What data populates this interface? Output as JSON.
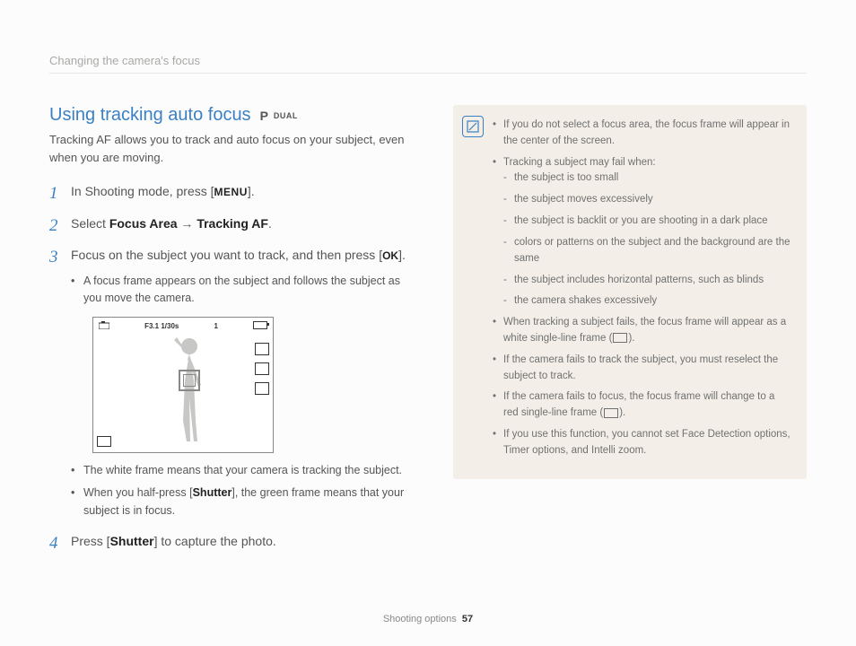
{
  "breadcrumb": "Changing the camera's focus",
  "title": "Using tracking auto focus",
  "mode_badges": {
    "p": "P",
    "dual": "DUAL"
  },
  "intro": "Tracking AF allows you to track and auto focus on your subject, even when you are moving.",
  "steps": {
    "s1_a": "In Shooting mode, press [",
    "s1_menu": "MENU",
    "s1_b": "].",
    "s2_a": "Select ",
    "s2_focus": "Focus Area",
    "s2_arrow": " → ",
    "s2_track": "Tracking AF",
    "s2_b": ".",
    "s3_a": "Focus on the subject you want to track, and then press [",
    "s3_ok": "OK",
    "s3_b": "].",
    "s3_sub1": "A focus frame appears on the subject and follows the subject as you move the camera.",
    "s3_sub2": "The white frame means that your camera is tracking the subject.",
    "s3_sub3_a": "When you half-press [",
    "s3_sub3_shutter": "Shutter",
    "s3_sub3_b": "], the green frame means that your subject is in focus.",
    "s4_a": "Press [",
    "s4_shutter": "Shutter",
    "s4_b": "] to capture the photo."
  },
  "lcd": {
    "fstop": "F3.1",
    "shutter": "1/30s",
    "count": "1"
  },
  "note": {
    "n1": "If you do not select a focus area, the focus frame will appear in the center of the screen.",
    "n2": "Tracking a subject may fail when:",
    "n2a": "the subject is too small",
    "n2b": "the subject moves excessively",
    "n2c": "the subject is backlit or you are shooting in a dark place",
    "n2d": "colors or patterns on the subject and the background are the same",
    "n2e": "the subject includes horizontal patterns, such as blinds",
    "n2f": "the camera shakes excessively",
    "n3a": "When tracking a subject fails, the focus frame will appear as a white single-line frame (",
    "n3b": ").",
    "n4": "If the camera fails to track the subject, you must reselect the subject to track.",
    "n5a": "If the camera fails to focus, the focus frame will change to a red single-line frame (",
    "n5b": ").",
    "n6": "If you use this function, you cannot set Face Detection options, Timer options, and Intelli zoom."
  },
  "footer": {
    "section": "Shooting options",
    "page": "57"
  }
}
